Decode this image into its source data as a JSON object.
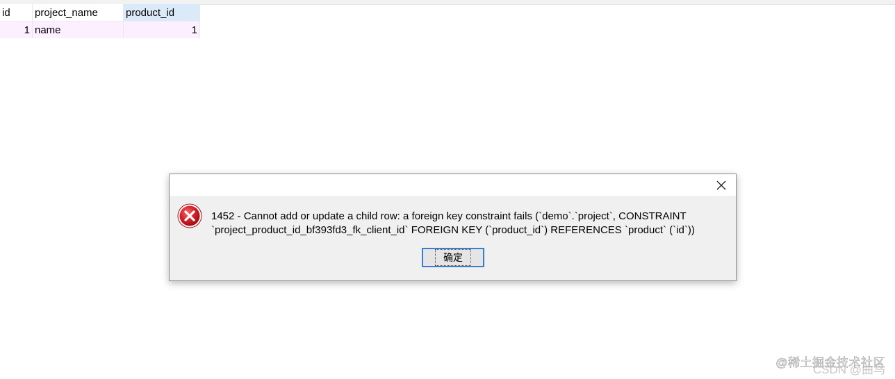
{
  "grid": {
    "columns": [
      "id",
      "project_name",
      "product_id"
    ],
    "selected_column": "product_id",
    "rows": [
      {
        "id": "1",
        "project_name": "name",
        "product_id": "1"
      }
    ]
  },
  "dialog": {
    "close_icon": "close-icon",
    "error_icon": "error-icon",
    "message_line1": "1452 - Cannot add or update a child row: a foreign key constraint fails (`demo`.`project`, CONSTRAINT",
    "message_line2": "`project_product_id_bf393fd3_fk_client_id` FOREIGN KEY (`product_id`) REFERENCES `product` (`id`))",
    "ok_label": "确定",
    "colors": {
      "accent": "#3a7bd5",
      "error_red": "#c8141e"
    }
  },
  "watermark": {
    "line1": "@稀土掘金技术社区",
    "line2": "CSDN @曲鸟"
  }
}
